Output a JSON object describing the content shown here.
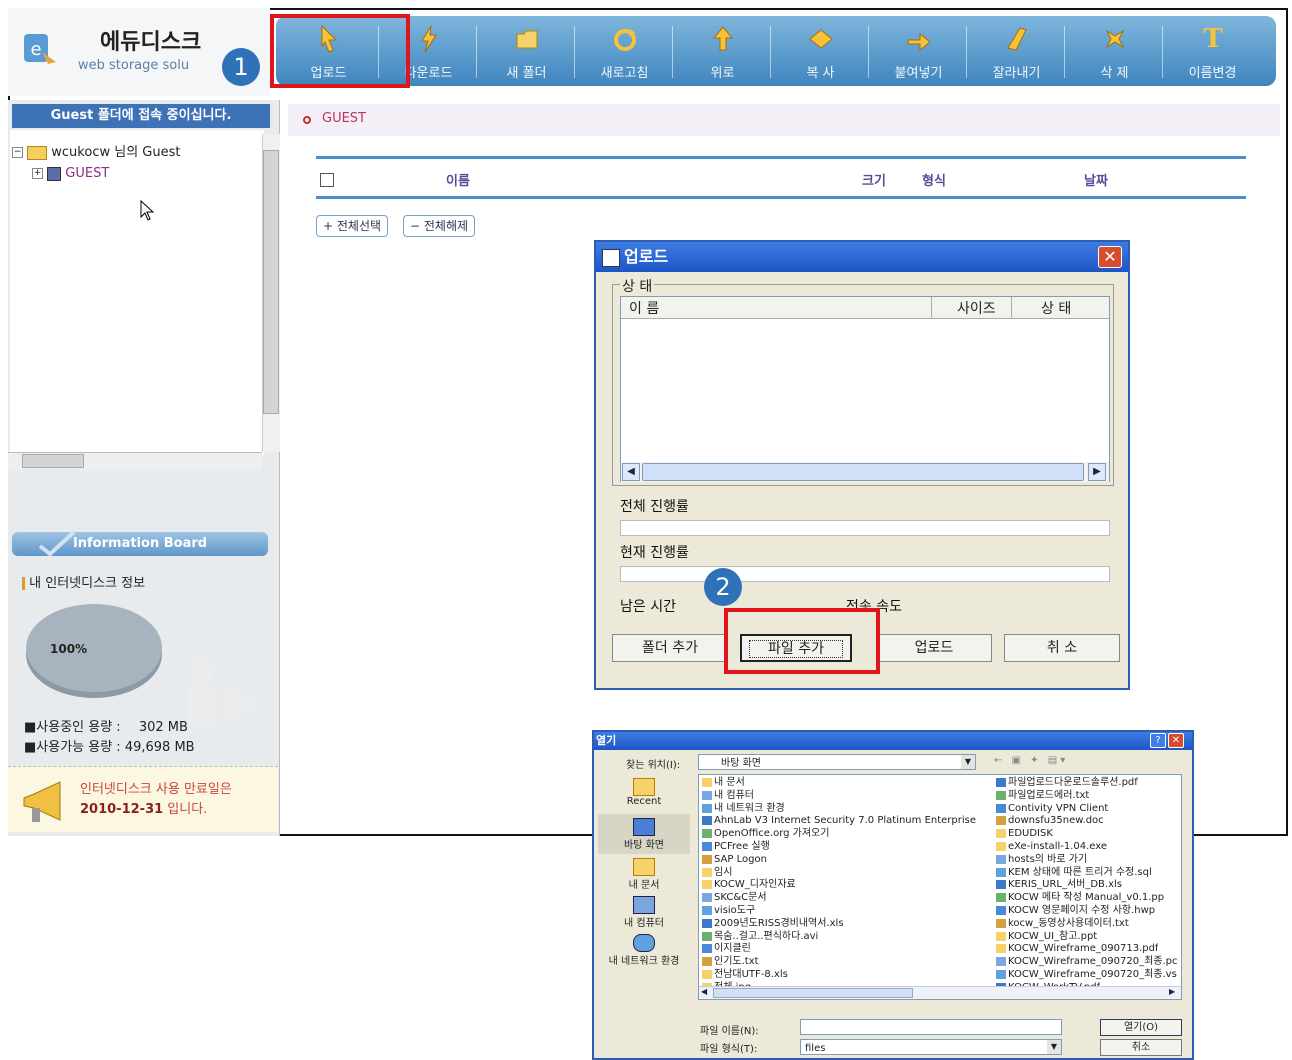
{
  "logo": {
    "title": "에듀디스크",
    "subtitle": "web storage solu"
  },
  "steps": {
    "one": "1",
    "two": "2"
  },
  "toolbar": {
    "items": [
      {
        "label": "업로드",
        "icon": "cursor-icon"
      },
      {
        "label": "다운로드",
        "icon": "lightning-icon"
      },
      {
        "label": "새 폴더",
        "icon": "folder-icon"
      },
      {
        "label": "새로고침",
        "icon": "refresh-icon"
      },
      {
        "label": "위로",
        "icon": "up-arrow-icon"
      },
      {
        "label": "복 사",
        "icon": "copy-icon"
      },
      {
        "label": "붙여넣기",
        "icon": "paste-icon"
      },
      {
        "label": "잘라내기",
        "icon": "cut-icon"
      },
      {
        "label": "삭 제",
        "icon": "delete-icon"
      },
      {
        "label": "이름변경",
        "icon": "rename-icon"
      }
    ]
  },
  "sidebar": {
    "header": "Guest 폴더에 접속 중이십니다.",
    "tree_root": "wcukocw 님의 Guest",
    "tree_child": "GUEST",
    "info_board": "Information Board",
    "my_info": "내 인터넷디스크 정보",
    "pie_label": "100%",
    "used_label": "■사용중인 용량 :",
    "used_value": "302 MB",
    "avail_label": "■사용가능 용량 :",
    "avail_value": "49,698 MB",
    "expire_line1": "인터넷디스크 사용 만료일은",
    "expire_date": "2010-12-31",
    "expire_suffix": " 입니다."
  },
  "main": {
    "breadcrumb": "GUEST",
    "columns": {
      "name": "이름",
      "size": "크기",
      "type": "형식",
      "date": "날짜"
    },
    "select_all": "+ 전체선택",
    "deselect_all": "− 전체해제"
  },
  "upload_dialog": {
    "title": "업로드",
    "status_group": "상 태",
    "col_name": "이 름",
    "col_size": "사이즈",
    "col_status": "상 태",
    "total_progress": "전체 진행률",
    "current_progress": "현재 진행률",
    "remaining_time": "남은 시간",
    "transfer_speed": "전송 속도",
    "buttons": {
      "add_folder": "폴더 추가",
      "add_file": "파일 추가",
      "upload": "업로드",
      "cancel": "취 소"
    }
  },
  "open_dialog": {
    "title": "열기",
    "look_in_label": "찾는 위치(I):",
    "look_in_value": "바탕 화면",
    "places": [
      "Recent",
      "바탕 화면",
      "내 문서",
      "내 컴퓨터",
      "내 네트워크 환경"
    ],
    "files_left": [
      "내 문서",
      "내 컴퓨터",
      "내 네트워크 환경",
      "AhnLab V3 Internet Security 7.0 Platinum Enterprise",
      "OpenOffice.org 가져오기",
      "PCFree 실행",
      "SAP Logon",
      "임시",
      "KOCW_디자인자료",
      "SKC&C문서",
      "visio도구",
      "2009년도RISS경비내역서.xls",
      "목숨..걸고..편식하다.avi",
      "이지클린",
      "인기도.txt",
      "전남대UTF-8.xls",
      "전체.jpg"
    ],
    "files_right": [
      "파일업로드다운로드솔루션.pdf",
      "파일업로드에러.txt",
      "Contivity VPN Client",
      "downsfu35new.doc",
      "EDUDISK",
      "eXe-install-1.04.exe",
      "hosts의 바로 가기",
      "KEM 상태에 따른 트리거 수정.sql",
      "KERIS_URL_서버_DB.xls",
      "KOCW 메타 작성 Manual_v0.1.pp",
      "KOCW 영문페이지 수정 사항.hwp",
      "kocw_동영상사용데이터.txt",
      "KOCW_UI_참고.ppt",
      "KOCW_Wireframe_090713.pdf",
      "KOCW_Wireframe_090720_최종.pc",
      "KOCW_Wireframe_090720_최종.vs",
      "KOCW_WorkTV.pdf"
    ],
    "filename_label": "파일 이름(N):",
    "filename_value": "",
    "filetype_label": "파일 형식(T):",
    "filetype_value": "files",
    "open_button": "열기(O)",
    "cancel_button": "취소"
  },
  "colors": {
    "accent": "#3e72b6",
    "highlight": "#e0141b",
    "step": "#2f72b8"
  }
}
